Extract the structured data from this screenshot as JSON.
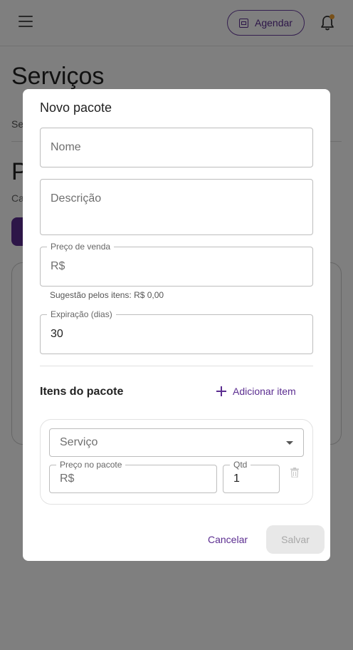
{
  "app": {
    "page_title": "Serviços",
    "schedule_button": "Agendar",
    "tab_fragment": "Se",
    "section_fragment": "P",
    "caption_fragment": "Ca"
  },
  "dialog": {
    "title": "Novo pacote",
    "name_placeholder": "Nome",
    "description_placeholder": "Descrição",
    "price_label": "Preço de venda",
    "price_prefix": "R$",
    "price_helper": "Sugestão pelos itens: R$ 0,00",
    "expiration_label": "Expiração (dias)",
    "expiration_value": "30",
    "items_title": "Itens do pacote",
    "add_item_label": "Adicionar item",
    "item": {
      "service_placeholder": "Serviço",
      "package_price_label": "Preço no pacote",
      "package_price_prefix": "R$",
      "qty_label": "Qtd",
      "qty_value": "1"
    },
    "cancel_label": "Cancelar",
    "save_label": "Salvar"
  },
  "colors": {
    "accent": "#5b2d90",
    "notification_dot": "#f0a030",
    "overlay": "rgba(0,0,0,0.5)"
  }
}
